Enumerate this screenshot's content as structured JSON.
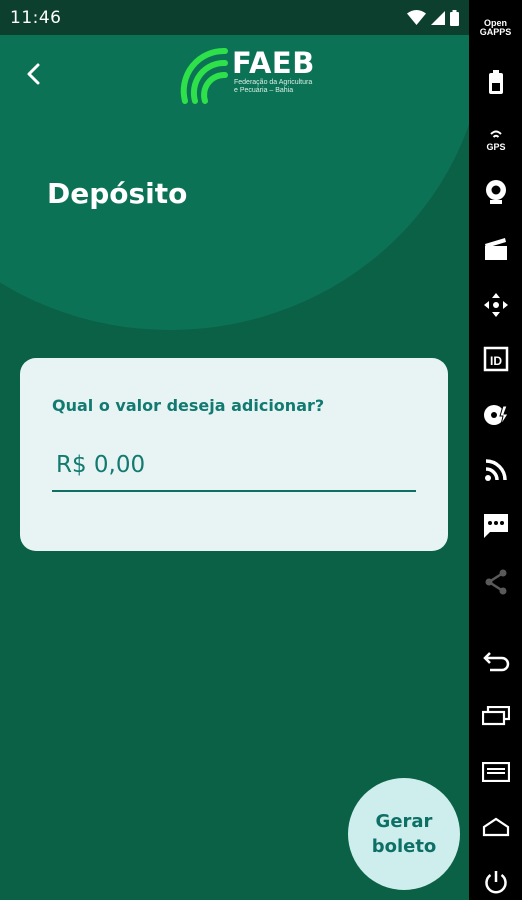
{
  "status_bar": {
    "time": "11:46"
  },
  "header": {
    "logo_text": "FAEB",
    "logo_subtitle": "Federação da Agricultura e Pecuária – Bahia",
    "title": "Depósito"
  },
  "deposit_card": {
    "label": "Qual o valor deseja adicionar?",
    "amount_value": "R$ 0,00"
  },
  "action_button": {
    "label": "Gerar\nboleto"
  },
  "side_toolbar": {
    "gapps_label": "Open\nGAPPS",
    "icons": [
      "battery-icon",
      "gps-icon",
      "webcam-icon",
      "clapperboard-icon",
      "dpad-icon",
      "id-icon",
      "disk-icon",
      "rss-icon",
      "sms-icon",
      "share-icon",
      "back-icon",
      "recent-apps-icon",
      "menu-icon",
      "home-icon",
      "power-icon"
    ]
  },
  "colors": {
    "background": "#0b6146",
    "arc": "#0c7256",
    "card": "#e8f4f3",
    "accent": "#127a71",
    "logo_green": "#2ee04a",
    "fab": "#cdeeed"
  }
}
